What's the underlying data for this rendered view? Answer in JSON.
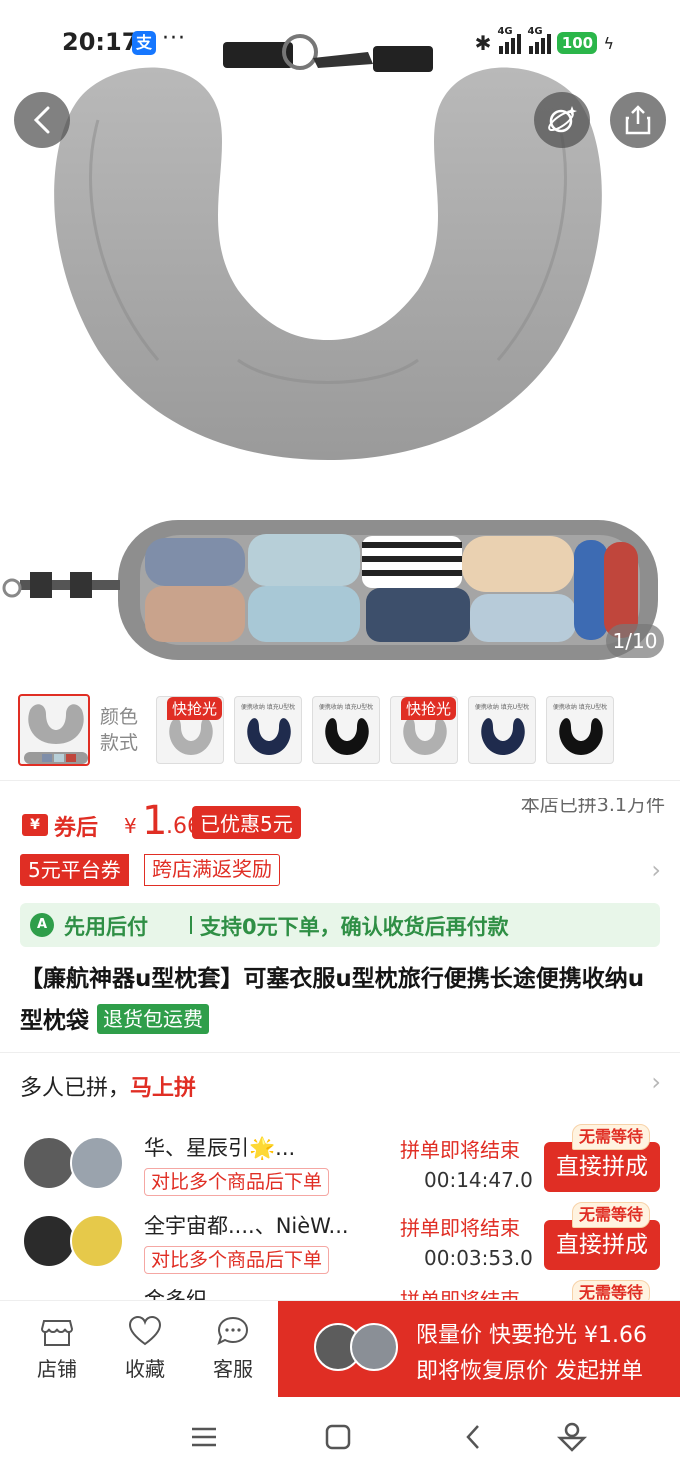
{
  "status_bar": {
    "time": "20:17",
    "alipay_badge": "支",
    "more": "···",
    "network1": "4G",
    "network2": "4G",
    "battery": "100"
  },
  "hero": {
    "image_counter": "1/10"
  },
  "variants": {
    "label": "颜色款式",
    "thumbs": [
      {
        "flash": "快抢光",
        "title": ""
      },
      {
        "flash": "",
        "title": "便携收纳 填充U型枕"
      },
      {
        "flash": "",
        "title": "便携收纳 填充U型枕"
      },
      {
        "flash": "快抢光",
        "title": ""
      },
      {
        "flash": "",
        "title": "便携收纳 填充U型枕"
      },
      {
        "flash": "",
        "title": "便携收纳 填充U型枕"
      }
    ]
  },
  "price": {
    "coupon_icon": "¥",
    "prefix": "券后",
    "currency": "¥",
    "integer": "1",
    "decimal": ".66",
    "discount": "已优惠5元",
    "sold": "本店已拼3.1万件"
  },
  "coupons": {
    "platform": "5元平台券",
    "cross_store": "跨店满返奖励"
  },
  "pay_later": {
    "icon": "A",
    "title": "先用后付",
    "desc": "支持0元下单，确认收货后再付款"
  },
  "product": {
    "title": "【廉航神器u型枕套】可塞衣服u型枕旅行便携长途便携收纳u型枕袋",
    "return_tag": "退货包运费"
  },
  "group_buy": {
    "plain": "多人已拼，",
    "join": "马上拼",
    "rows": [
      {
        "name": "华、星辰引🌟...",
        "tag": "对比多个商品后下单",
        "ending": "拼单即将结束",
        "timer": "00:14:47.0",
        "button": "直接拼成",
        "badge": "无需等待"
      },
      {
        "name": "全宇宙都....、NièW...",
        "tag": "对比多个商品后下单",
        "ending": "拼单即将结束",
        "timer": "00:03:53.0",
        "button": "直接拼成",
        "badge": "无需等待"
      },
      {
        "name": "金多织、…",
        "tag": "",
        "ending": "拼单即将结束",
        "timer": "",
        "button": "",
        "badge": "无需等待"
      }
    ]
  },
  "bottom_bar": {
    "store": "店铺",
    "favorite": "收藏",
    "service": "客服",
    "cta_line1": "限量价 快要抢光 ¥1.66",
    "cta_line2": "即将恢复原价 发起拼单"
  },
  "colors": {
    "accent": "#e02e24",
    "green": "#2f9e4a"
  }
}
